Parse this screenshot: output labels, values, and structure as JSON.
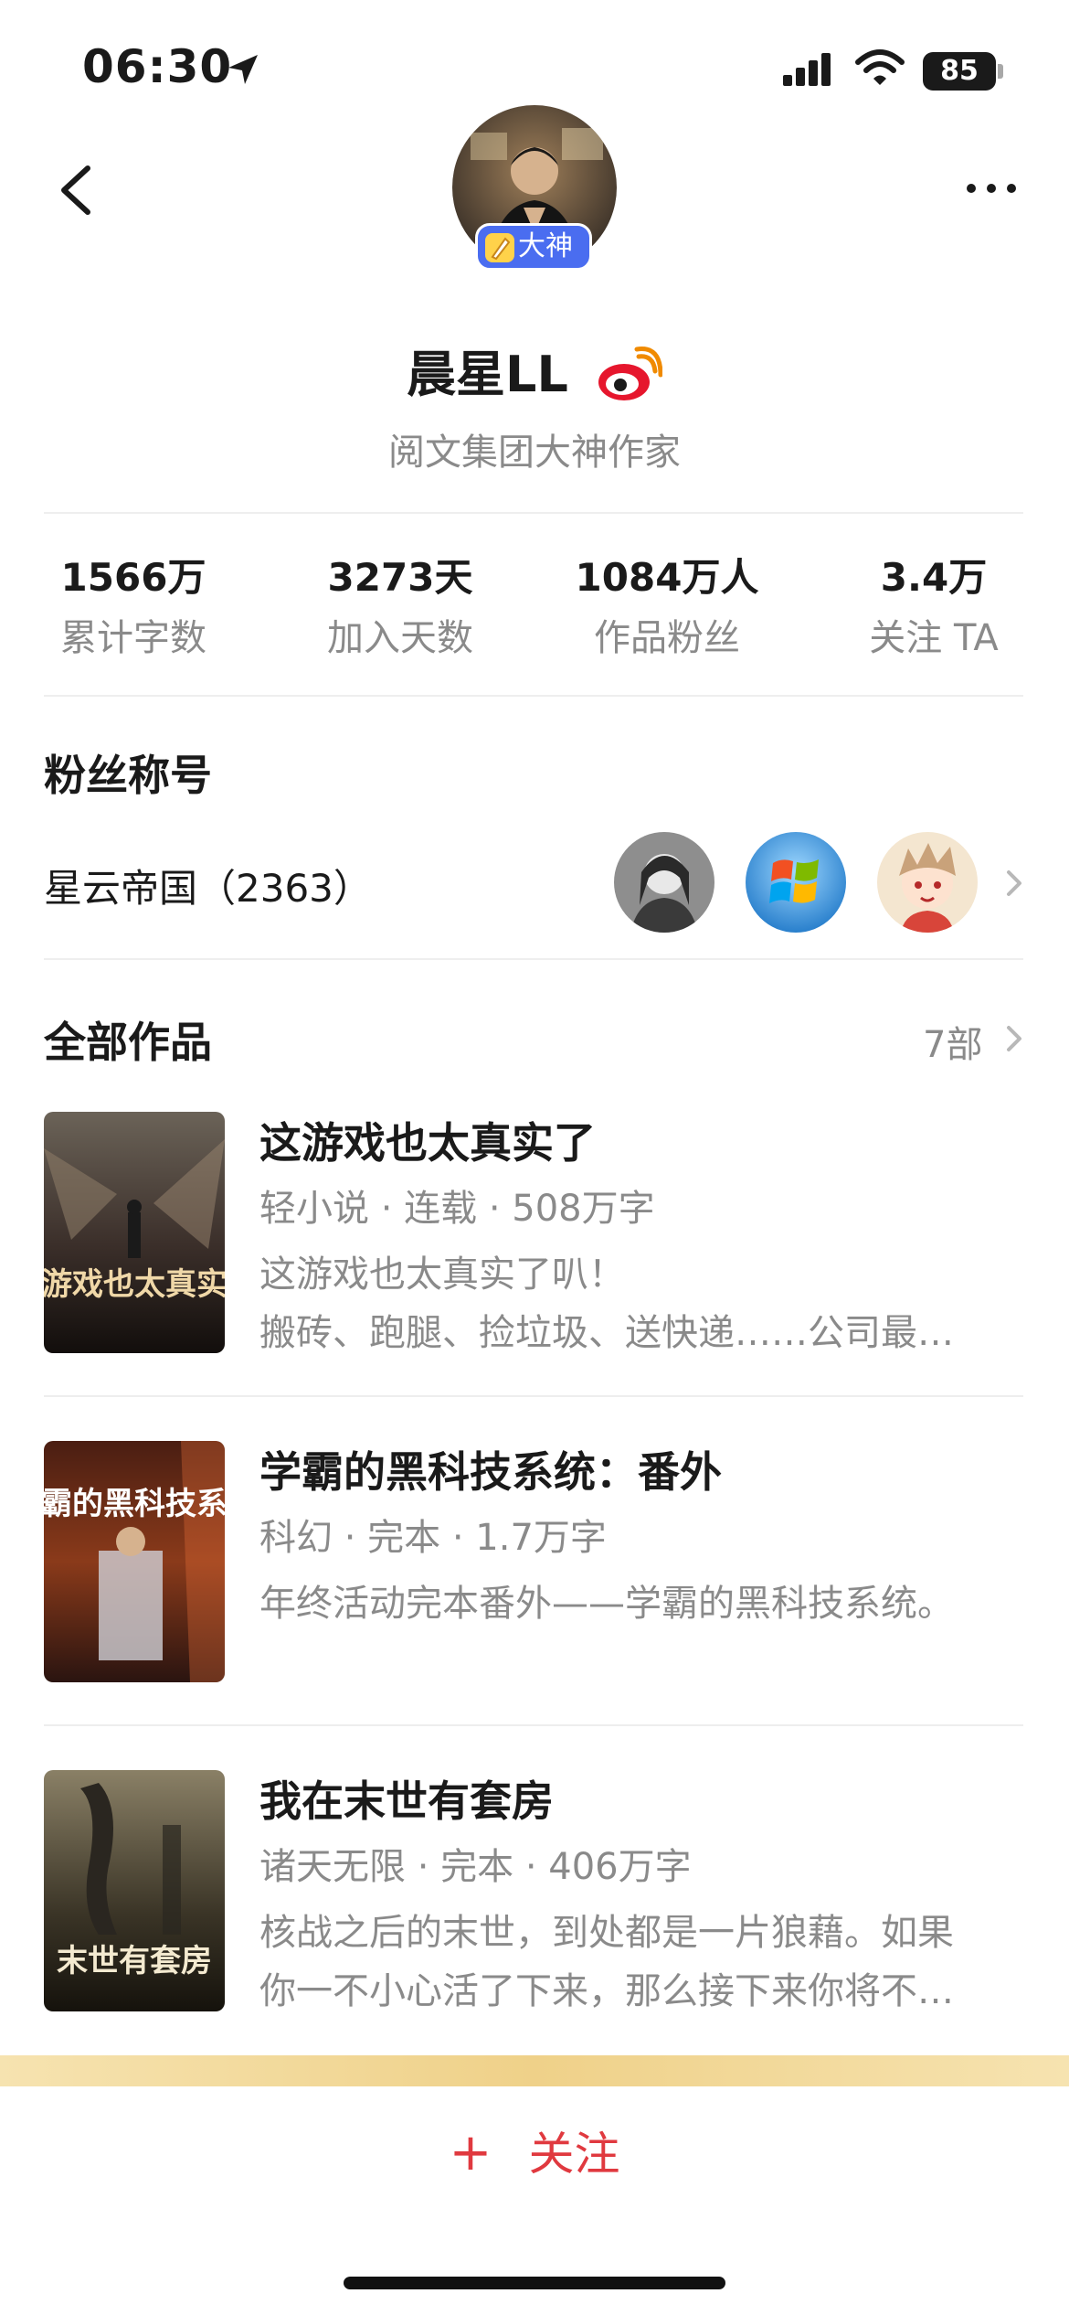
{
  "status_bar": {
    "time": "06:30",
    "battery": "85"
  },
  "profile": {
    "badge": "大神",
    "name": "晨星LL",
    "subtitle": "阅文集团大神作家"
  },
  "stats": [
    {
      "value": "1566万",
      "label": "累计字数"
    },
    {
      "value": "3273天",
      "label": "加入天数"
    },
    {
      "value": "1084万人",
      "label": "作品粉丝"
    },
    {
      "value": "3.4万",
      "label": "关注 TA"
    }
  ],
  "fans": {
    "title": "粉丝称号",
    "name": "星云帝国（2363）"
  },
  "works": {
    "title": "全部作品",
    "count": "7部",
    "books": [
      {
        "title": "这游戏也太真实了",
        "meta": "轻小说 · 连载 · 508万字",
        "desc": [
          "这游戏也太真实了叭！",
          "搬砖、跑腿、捡垃圾、送快递……公司最…"
        ],
        "cover_text": "这游戏也太真实了"
      },
      {
        "title": "学霸的黑科技系统：番外",
        "meta": "科幻 · 完本 · 1.7万字",
        "desc": [
          "年终活动完本番外——学霸的黑科技系统。"
        ],
        "cover_text": "学霸的黑科技系统"
      },
      {
        "title": "我在末世有套房",
        "meta": "诸天无限 · 完本 · 406万字",
        "desc": [
          "核战之后的末世，到处都是一片狼藉。如果",
          "你一不小心活了下来，那么接下来你将不…"
        ],
        "cover_text": "末世有套房"
      }
    ]
  },
  "follow": {
    "plus": "+",
    "label": "关注"
  },
  "colors": {
    "accent": "#e0393f",
    "badge": "#4a6df0",
    "muted": "#8a8a8a"
  }
}
